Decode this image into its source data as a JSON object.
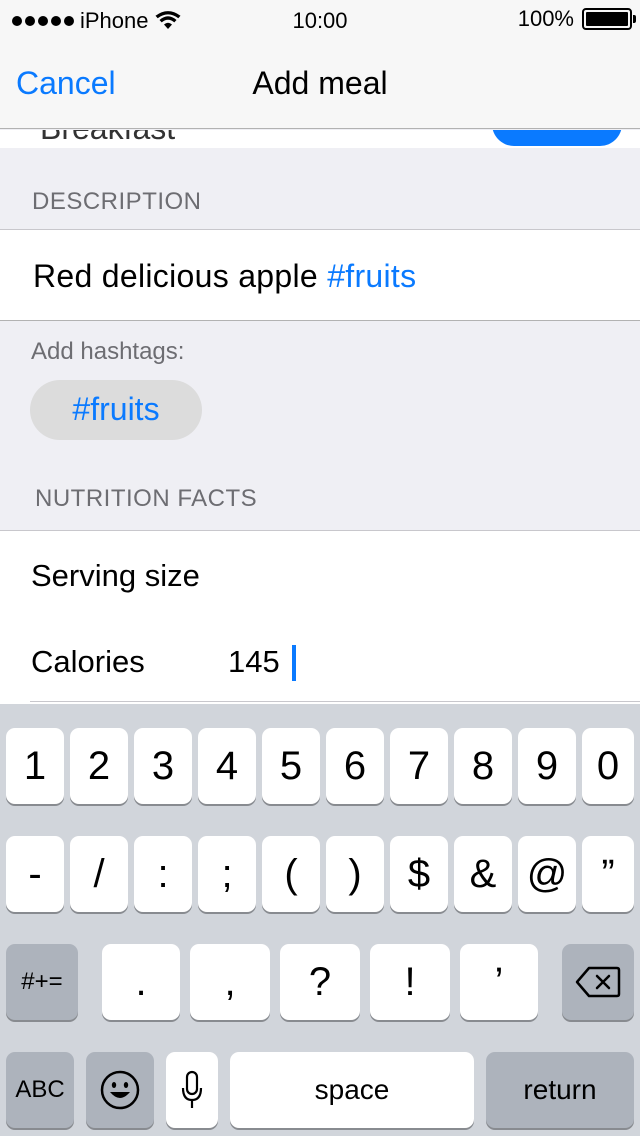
{
  "status_bar": {
    "carrier": "iPhone",
    "time": "10:00",
    "battery": "100%",
    "battery_level": 1.0
  },
  "nav": {
    "cancel_label": "Cancel",
    "title": "Add meal"
  },
  "meal_type_peek": {
    "label": "Breakfast"
  },
  "description": {
    "header": "DESCRIPTION",
    "text": "Red delicious apple ",
    "hashtag": "#fruits"
  },
  "hashtags": {
    "label": "Add hashtags:",
    "items": [
      "#fruits"
    ]
  },
  "nutrition": {
    "header": "NUTRITION FACTS",
    "serving_size_label": "Serving size",
    "calories_label": "Calories",
    "calories_value": "145"
  },
  "keyboard": {
    "row1": [
      "1",
      "2",
      "3",
      "4",
      "5",
      "6",
      "7",
      "8",
      "9",
      "0"
    ],
    "row2": [
      "-",
      "/",
      ":",
      ";",
      "(",
      ")",
      "$",
      "&",
      "@",
      "”"
    ],
    "row3_left": "#+=",
    "row3": [
      ".",
      ",",
      "?",
      "!",
      "’"
    ],
    "abc": "ABC",
    "space": "space",
    "return": "return"
  },
  "colors": {
    "accent": "#0a7aff",
    "keyboard_bg": "#d1d5db",
    "dark_key": "#adb3bc"
  }
}
